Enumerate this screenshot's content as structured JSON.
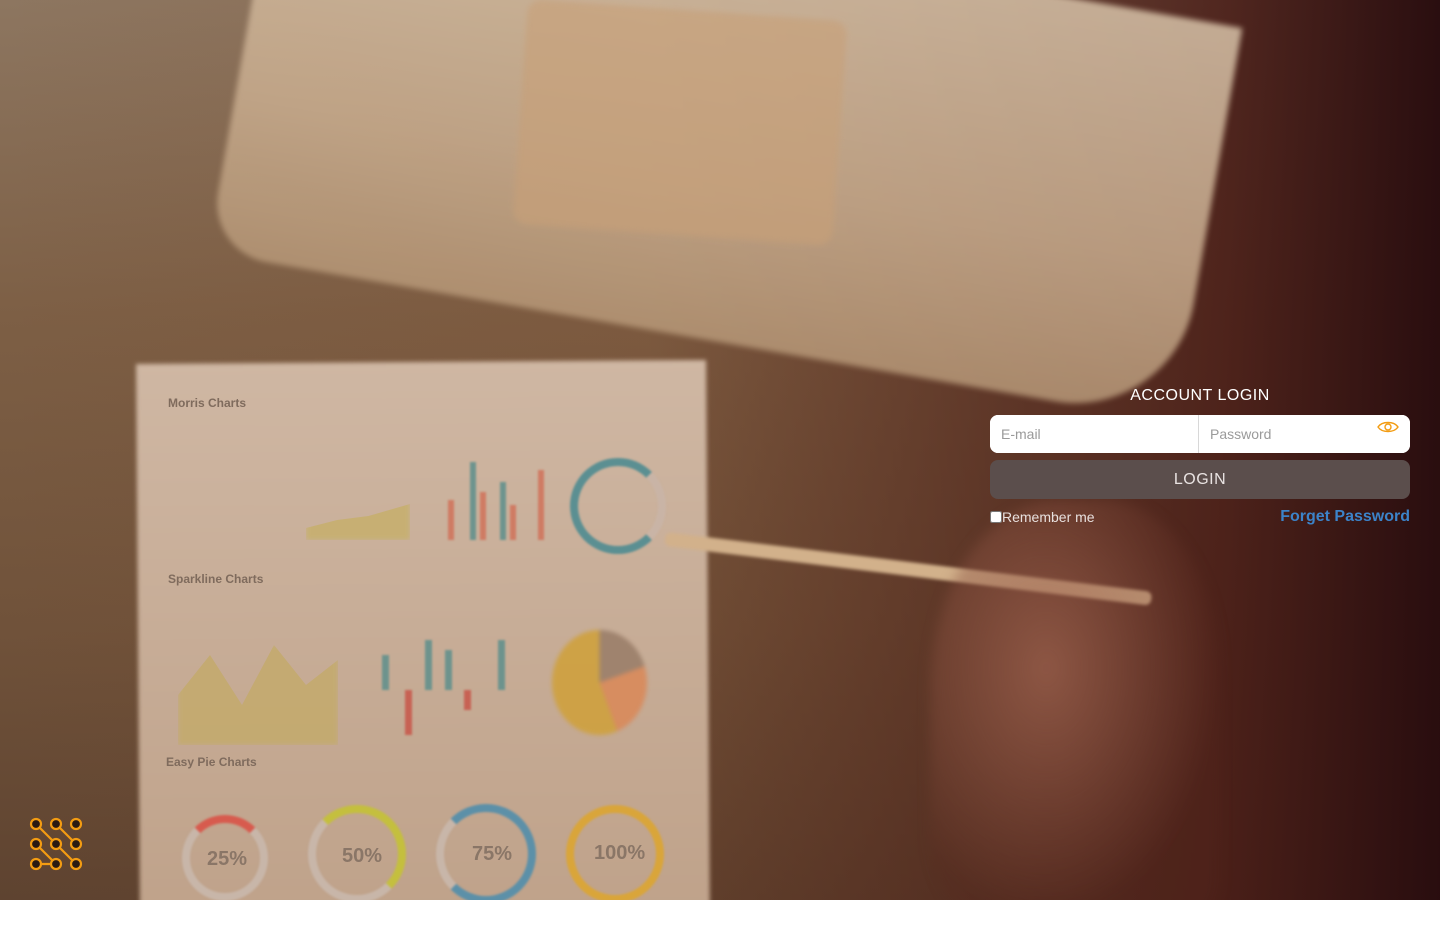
{
  "login": {
    "title": "ACCOUNT LOGIN",
    "email_placeholder": "E-mail",
    "password_placeholder": "Password",
    "login_button": "LOGIN",
    "remember_label": "Remember me",
    "remember_checked": false,
    "forget_link": "Forget Password"
  },
  "icons": {
    "password_toggle": "eye-icon",
    "logo": "node-grid-logo-icon"
  },
  "colors": {
    "accent": "#f39c12",
    "link": "#3c83c9",
    "login_button_bg": "#5b4e4c"
  },
  "background_sheet": {
    "section_1": "Morris Charts",
    "section_2": "Sparkline Charts",
    "section_3": "Easy Pie Charts",
    "pie_1": "25%",
    "pie_2": "50%",
    "pie_3": "75%",
    "pie_4": "100%"
  }
}
